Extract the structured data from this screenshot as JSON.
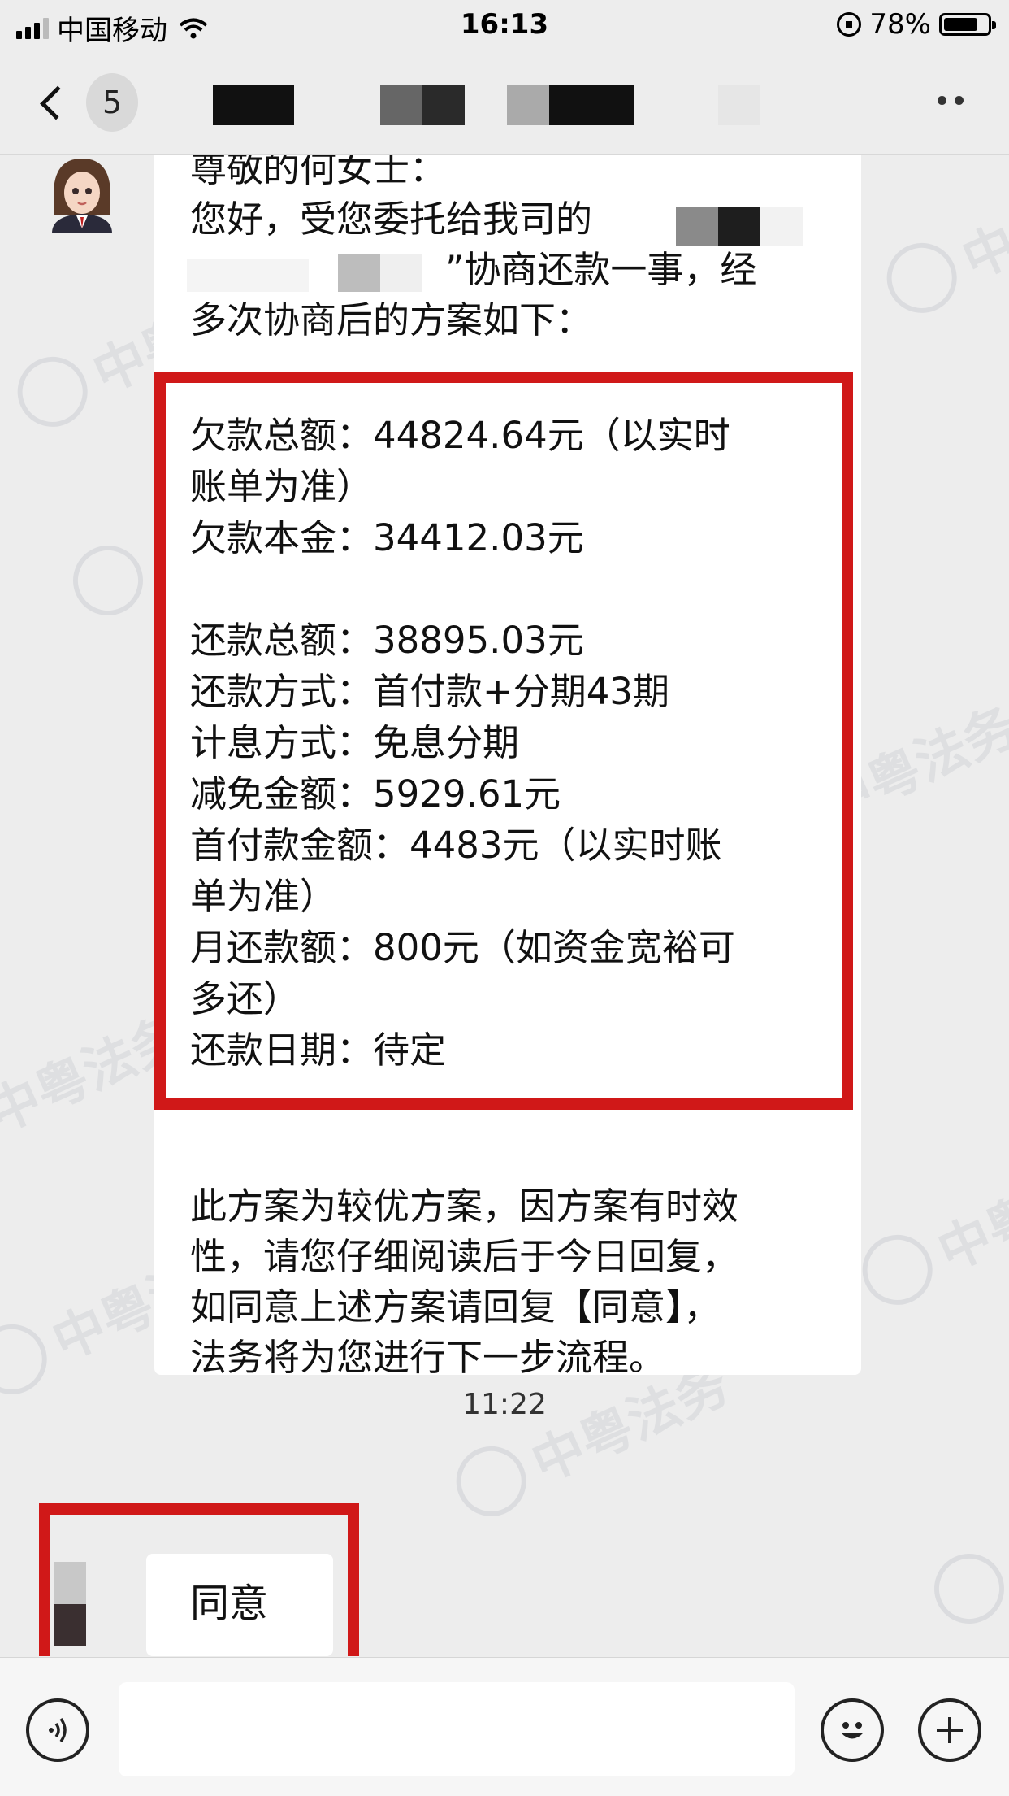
{
  "status_bar": {
    "carrier": "中国移动",
    "time": "16:13",
    "battery_percent_label": "78%",
    "battery_level": 0.78
  },
  "nav": {
    "unread_count": "5"
  },
  "message": {
    "intro_lines": [
      "尊敬的何女士：",
      "您好，受您委托给我司的",
      "”协商还款一事，经",
      "多次协商后的方案如下："
    ],
    "plan_lines": [
      "欠款总额：44824.64元（以实时",
      "账单为准）",
      "欠款本金：34412.03元",
      "",
      "还款总额：38895.03元",
      "还款方式：首付款+分期43期",
      "计息方式：免息分期",
      "减免金额：5929.61元",
      "首付款金额：4483元（以实时账",
      "单为准）",
      "月还款额：800元（如资金宽裕可",
      "多还）",
      "还款日期：待定"
    ],
    "closing_lines": [
      "此方案为较优方案，因方案有时效",
      "性，请您仔细阅读后于今日回复，",
      "如同意上述方案请回复【同意】，",
      "法务将为您进行下一步流程。"
    ]
  },
  "timestamp": "11:22",
  "reply": {
    "text": "同意"
  },
  "watermark_text": "中粤法务",
  "colors": {
    "highlight_red": "#d01818",
    "chat_bg": "#ededed",
    "bubble_bg": "#ffffff"
  },
  "icons": [
    "signal-icon",
    "wifi-icon",
    "rotation-lock-icon",
    "battery-icon",
    "back-chevron-icon",
    "more-icon",
    "voice-icon",
    "emoji-icon",
    "plus-icon"
  ]
}
